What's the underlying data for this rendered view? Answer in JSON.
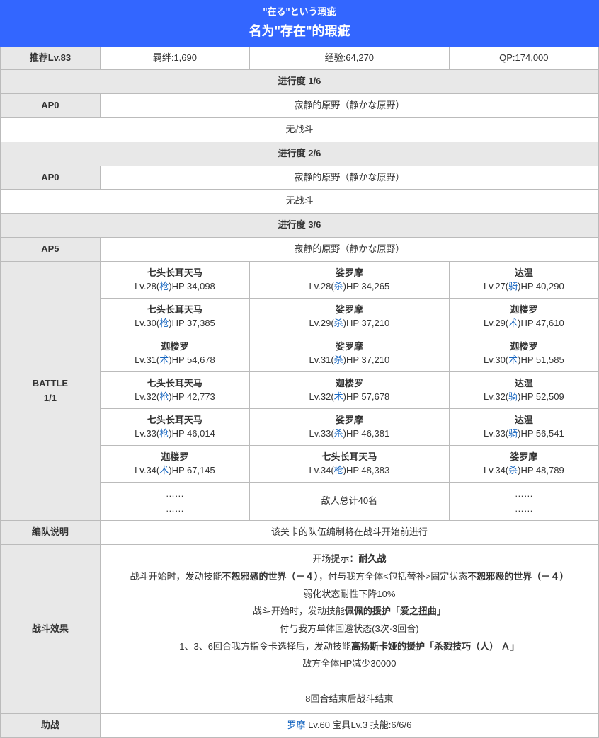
{
  "header": {
    "jp": "\"在る\"という瑕疵",
    "cn": "名为\"存在\"的瑕疵"
  },
  "rec": {
    "lv": "推荐Lv.83",
    "bond": "羁绊:1,690",
    "exp": "经验:64,270",
    "qp": "QP:174,000"
  },
  "prog": {
    "p1": "进行度 1/6",
    "p2": "进行度 2/6",
    "p3": "进行度 3/6"
  },
  "ap": {
    "ap0": "AP0",
    "ap5": "AP5"
  },
  "loc": "寂静的原野（静かな原野）",
  "nobattle": "无战斗",
  "battle": "BATTLE\n1/1",
  "enemies": [
    [
      {
        "n": "七头长耳天马",
        "lv": "Lv.28(",
        "cls": "枪",
        "hp": ")HP 34,098"
      },
      {
        "n": "娑罗摩",
        "lv": "Lv.28(",
        "cls": "杀",
        "hp": ")HP 34,265"
      },
      {
        "n": "达温",
        "lv": "Lv.27(",
        "cls": "骑",
        "hp": ")HP 40,290"
      }
    ],
    [
      {
        "n": "七头长耳天马",
        "lv": "Lv.30(",
        "cls": "枪",
        "hp": ")HP 37,385"
      },
      {
        "n": "娑罗摩",
        "lv": "Lv.29(",
        "cls": "杀",
        "hp": ")HP 37,210"
      },
      {
        "n": "迦楼罗",
        "lv": "Lv.29(",
        "cls": "术",
        "hp": ")HP 47,610"
      }
    ],
    [
      {
        "n": "迦楼罗",
        "lv": "Lv.31(",
        "cls": "术",
        "hp": ")HP 54,678"
      },
      {
        "n": "娑罗摩",
        "lv": "Lv.31(",
        "cls": "杀",
        "hp": ")HP 37,210"
      },
      {
        "n": "迦楼罗",
        "lv": "Lv.30(",
        "cls": "术",
        "hp": ")HP 51,585"
      }
    ],
    [
      {
        "n": "七头长耳天马",
        "lv": "Lv.32(",
        "cls": "枪",
        "hp": ")HP 42,773"
      },
      {
        "n": "迦楼罗",
        "lv": "Lv.32(",
        "cls": "术",
        "hp": ")HP 57,678"
      },
      {
        "n": "达温",
        "lv": "Lv.32(",
        "cls": "骑",
        "hp": ")HP 52,509"
      }
    ],
    [
      {
        "n": "七头长耳天马",
        "lv": "Lv.33(",
        "cls": "枪",
        "hp": ")HP 46,014"
      },
      {
        "n": "娑罗摩",
        "lv": "Lv.33(",
        "cls": "杀",
        "hp": ")HP 46,381"
      },
      {
        "n": "达温",
        "lv": "Lv.33(",
        "cls": "骑",
        "hp": ")HP 56,541"
      }
    ],
    [
      {
        "n": "迦楼罗",
        "lv": "Lv.34(",
        "cls": "术",
        "hp": ")HP 67,145"
      },
      {
        "n": "七头长耳天马",
        "lv": "Lv.34(",
        "cls": "枪",
        "hp": ")HP 48,383"
      },
      {
        "n": "娑罗摩",
        "lv": "Lv.34(",
        "cls": "杀",
        "hp": ")HP 48,789"
      }
    ]
  ],
  "dots": "……",
  "total": "敌人总计40名",
  "team": {
    "label": "编队说明",
    "text": "该关卡的队伍编制将在战斗开始前进行"
  },
  "eff": {
    "label": "战斗效果",
    "l1": "开场提示：",
    "l1b": "耐久战",
    "l2a": "战斗开始时，发动技能",
    "l2b": "不恕邪恶的世界（－４）",
    "l2c": "，付与我方全体<包括替补>固定状态",
    "l2d": "不恕邪恶的世界（－４）",
    "l3": "弱化状态耐性下降10%",
    "l4a": "战斗开始时，发动技能",
    "l4b": "佩佩的援护「爱之扭曲」",
    "l5": "付与我方单体回避状态(3次·3回合)",
    "l6a": "1、3、6回合我方指令卡选择后，发动技能",
    "l6b": "高扬斯卡娅的援护「杀戮技巧（人） Ａ」",
    "l7": "敌方全体HP减少30000",
    "l8": "8回合结束后战斗结束"
  },
  "sup": {
    "label": "助战",
    "name": "罗摩",
    "rest": " Lv.60 宝具Lv.3 技能:6/6/6"
  }
}
